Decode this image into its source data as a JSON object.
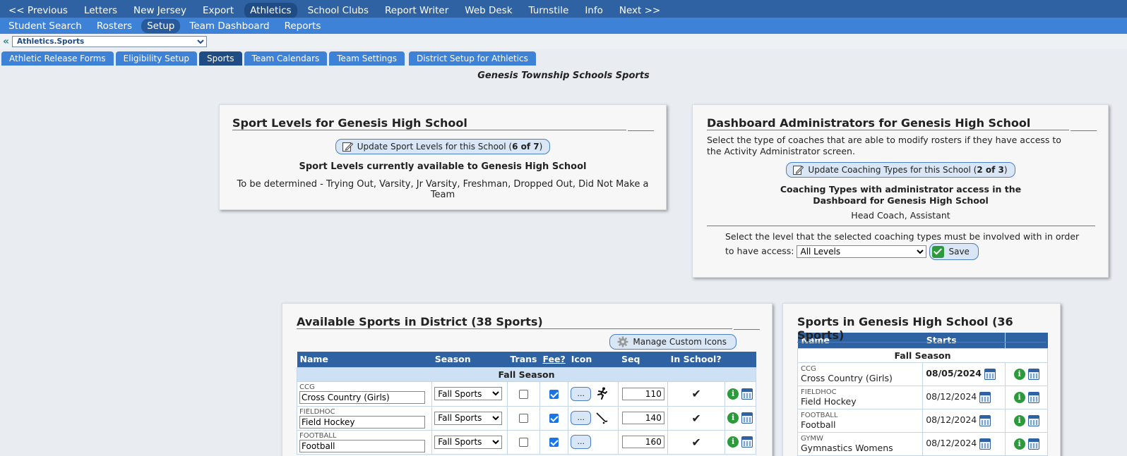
{
  "topnav": {
    "items": [
      "<< Previous",
      "Letters",
      "New Jersey",
      "Export",
      "Athletics",
      "School Clubs",
      "Report Writer",
      "Web Desk",
      "Turnstile",
      "Info",
      "Next >>"
    ],
    "active_index": 4
  },
  "subnav": {
    "items": [
      "Student Search",
      "Rosters",
      "Setup",
      "Team Dashboard",
      "Reports"
    ],
    "active_index": 2
  },
  "breadcrumb": {
    "back_icon": "«",
    "select_value": "Athletics.Sports"
  },
  "tabs": {
    "items": [
      "Athletic Release Forms",
      "Eligibility Setup",
      "Sports",
      "Team Calendars",
      "Team Settings",
      "District Setup for Athletics"
    ],
    "active_index": 2
  },
  "page_title": "Genesis Township Schools Sports",
  "sport_levels": {
    "title": "Sport Levels for Genesis High School",
    "button_prefix": "Update Sport Levels for this School (",
    "button_count": "6 of 7",
    "button_suffix": ")",
    "subtitle": "Sport Levels currently available to Genesis High School",
    "levels_text": "To be determined - Trying Out, Varsity, Jr Varsity, Freshman, Dropped Out, Did Not Make a Team"
  },
  "dashboard_admins": {
    "title": "Dashboard Administrators for Genesis High School",
    "description": "Select the type of coaches that are able to modify rosters if they have access to the Activity Administrator screen.",
    "button_prefix": "Update Coaching Types for this School (",
    "button_count": "2 of 3",
    "button_suffix": ")",
    "subtitle": "Coaching Types with administrator access in the Dashboard for Genesis High School",
    "types_text": "Head Coach, Assistant",
    "level_prompt": "Select the level that the selected coaching types must be involved with in order to have access:",
    "level_value": "All Levels",
    "save_label": "Save"
  },
  "district_sports": {
    "title": "Available Sports in District (38 Sports)",
    "manage_icons_label": "Manage Custom Icons",
    "columns": {
      "name": "Name",
      "season": "Season",
      "trans": "Trans",
      "fee": "Fee?",
      "icon": "Icon",
      "seq": "Seq",
      "in_school": "In School?"
    },
    "season_header": "Fall Season",
    "dots_label": "...",
    "info_glyph": "i",
    "rows": [
      {
        "code": "CCG",
        "name": "Cross Country (Girls)",
        "season": "Fall Sports",
        "trans": false,
        "fee": true,
        "icon": "runner-icon",
        "seq": "110",
        "in_school": true
      },
      {
        "code": "FIELDHOC",
        "name": "Field Hockey",
        "season": "Fall Sports",
        "trans": false,
        "fee": true,
        "icon": "hockey-stick-icon",
        "seq": "140",
        "in_school": true
      },
      {
        "code": "FOOTBALL",
        "name": "Football",
        "season": "Fall Sports",
        "trans": false,
        "fee": true,
        "icon": "",
        "seq": "160",
        "in_school": true
      }
    ]
  },
  "school_sports": {
    "title": "Sports in Genesis High School (36 Sports)",
    "columns": {
      "name": "Name",
      "starts": "Starts"
    },
    "season_header": "Fall Season",
    "info_glyph": "i",
    "rows": [
      {
        "code": "CCG",
        "name": "Cross Country (Girls)",
        "starts": "08/05/2024",
        "bold": true
      },
      {
        "code": "FIELDHOC",
        "name": "Field Hockey",
        "starts": "08/12/2024",
        "bold": false
      },
      {
        "code": "FOOTBALL",
        "name": "Football",
        "starts": "08/12/2024",
        "bold": false
      },
      {
        "code": "GYMW",
        "name": "Gymnastics Womens",
        "starts": "08/12/2024",
        "bold": false
      }
    ]
  },
  "colors": {
    "nav_dark": "#2e62a3",
    "nav_light": "#3d82d6",
    "accent_green": "#2b9a3b",
    "check_blue": "#1a73e8"
  }
}
